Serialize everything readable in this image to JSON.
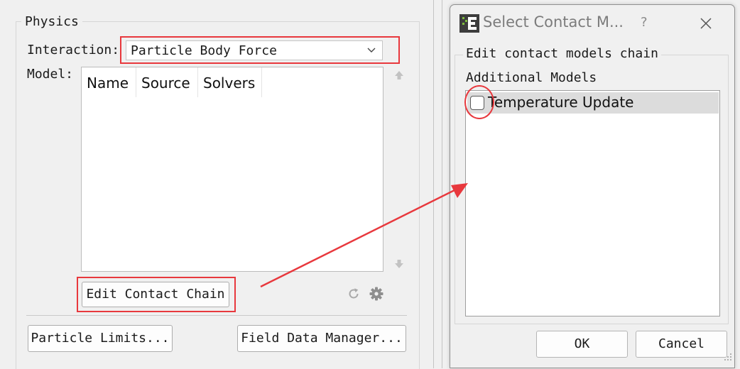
{
  "physics_panel": {
    "group_title": "Physics",
    "interaction_label": "Interaction:",
    "interaction_value": "Particle Body Force",
    "model_label": "Model:",
    "table_columns": [
      "Name",
      "Source",
      "Solvers"
    ],
    "edit_chain_label": "Edit Contact Chain",
    "particle_limits_label": "Particle Limits...",
    "field_data_label": "Field Data Manager..."
  },
  "dialog": {
    "title": "Select Contact M...",
    "help_glyph": "?",
    "group_title": "Edit contact models chain",
    "additional_label": "Additional Models",
    "models": [
      {
        "label": "Temperature Update",
        "checked": false
      }
    ],
    "ok_label": "OK",
    "cancel_label": "Cancel"
  },
  "icons": {
    "interaction_chevron": "chevron-down-icon",
    "move_up": "arrow-up-icon",
    "move_down": "arrow-down-icon",
    "refresh": "refresh-icon",
    "settings": "gear-icon",
    "app": "edem-app-icon",
    "close": "close-icon"
  },
  "colors": {
    "annotation": "#e8383d",
    "window_bg": "#f0f0f0",
    "selected_row": "#dcdcdc"
  }
}
